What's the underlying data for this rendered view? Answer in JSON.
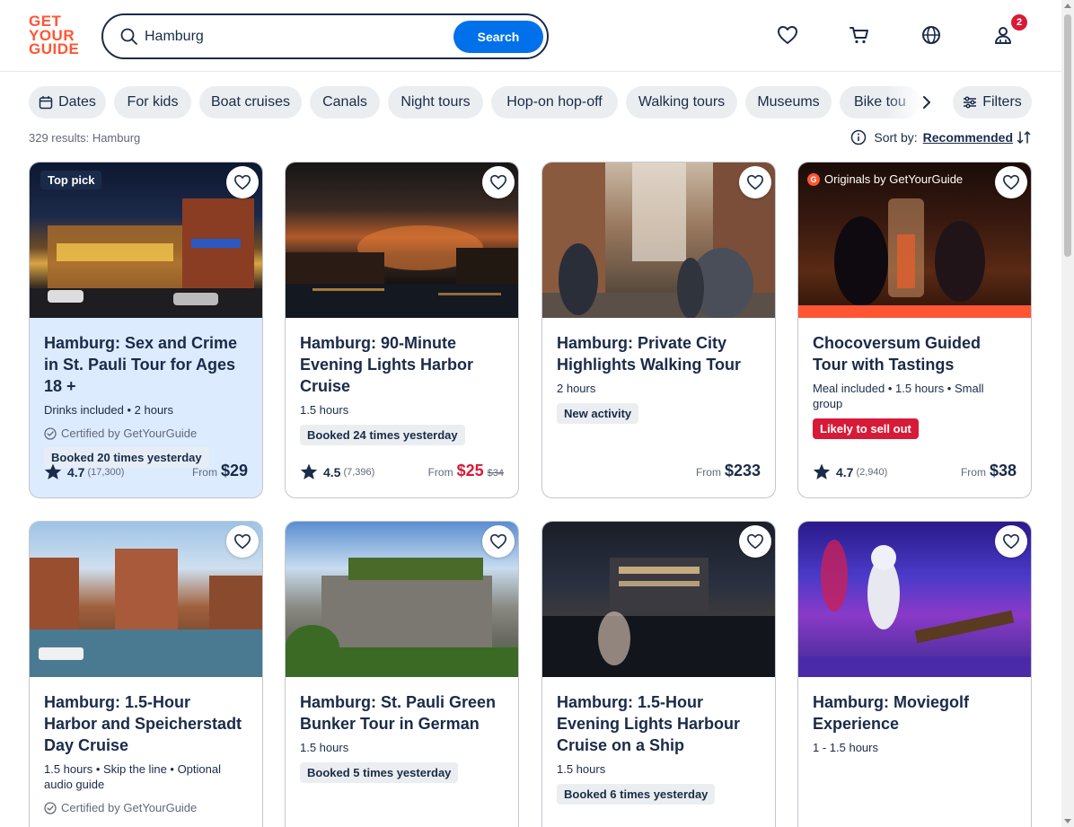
{
  "app": {
    "logo_lines": [
      "GET",
      "YOUR",
      "GUIDE"
    ],
    "brand_color": "#ff5533"
  },
  "search": {
    "value": "Hamburg",
    "button_label": "Search",
    "icon": "search-icon"
  },
  "header_icons": {
    "wishlist": "heart-icon",
    "cart": "cart-icon",
    "language": "globe-icon",
    "account": "user-icon",
    "account_badge": "2"
  },
  "chips": [
    {
      "label": "Dates",
      "icon": "calendar-icon"
    },
    {
      "label": "For kids"
    },
    {
      "label": "Boat cruises"
    },
    {
      "label": "Canals"
    },
    {
      "label": "Night tours"
    },
    {
      "label": "Hop-on hop-off"
    },
    {
      "label": "Walking tours"
    },
    {
      "label": "Museums"
    },
    {
      "label": "Bike tou"
    }
  ],
  "filters_label": "Filters",
  "results": {
    "count_text": "329 results: Hamburg",
    "sort_label": "Sort by:",
    "sort_value": "Recommended"
  },
  "cards": [
    {
      "tag": "Top pick",
      "title": "Hamburg: Sex and Crime in St. Pauli Tour for Ages 18 +",
      "meta": "Drinks included • 2 hours",
      "certified": "Certified by GetYourGuide",
      "pill": "Booked 20 times yesterday",
      "rating": "4.7",
      "rating_count": "(17,300)",
      "from": "From",
      "price": "$29"
    },
    {
      "title": "Hamburg: 90-Minute Evening Lights Harbor Cruise",
      "meta": "1.5 hours",
      "pill": "Booked 24 times yesterday",
      "rating": "4.5",
      "rating_count": "(7,396)",
      "from": "From",
      "price": "$25",
      "old_price": "$34"
    },
    {
      "title": "Hamburg: Private City Highlights Walking Tour",
      "meta": "2 hours",
      "pill": "New activity",
      "from": "From",
      "price": "$233"
    },
    {
      "originals": "Originals by GetYourGuide",
      "title": "Chocoversum Guided Tour with Tastings",
      "meta": "Meal included • 1.5 hours • Small group",
      "pill": "Likely to sell out",
      "rating": "4.7",
      "rating_count": "(2,940)",
      "from": "From",
      "price": "$38"
    },
    {
      "title": "Hamburg: 1.5-Hour Harbor and Speicherstadt Day Cruise",
      "meta": "1.5 hours • Skip the line • Optional audio guide",
      "certified": "Certified by GetYourGuide"
    },
    {
      "title": "Hamburg: St. Pauli Green Bunker Tour in German",
      "meta": "1.5 hours",
      "pill": "Booked 5 times yesterday"
    },
    {
      "title": "Hamburg: 1.5-Hour Evening Lights Harbour Cruise on a Ship",
      "meta": "1.5 hours",
      "pill": "Booked 6 times yesterday"
    },
    {
      "title": "Hamburg: Moviegolf Experience",
      "meta": "1 - 1.5 hours"
    }
  ],
  "colors": {
    "accent_blue": "#0071eb",
    "navy": "#1a2b49",
    "sale_red": "#d71a37",
    "highlight_bg": "#dcebfe"
  }
}
